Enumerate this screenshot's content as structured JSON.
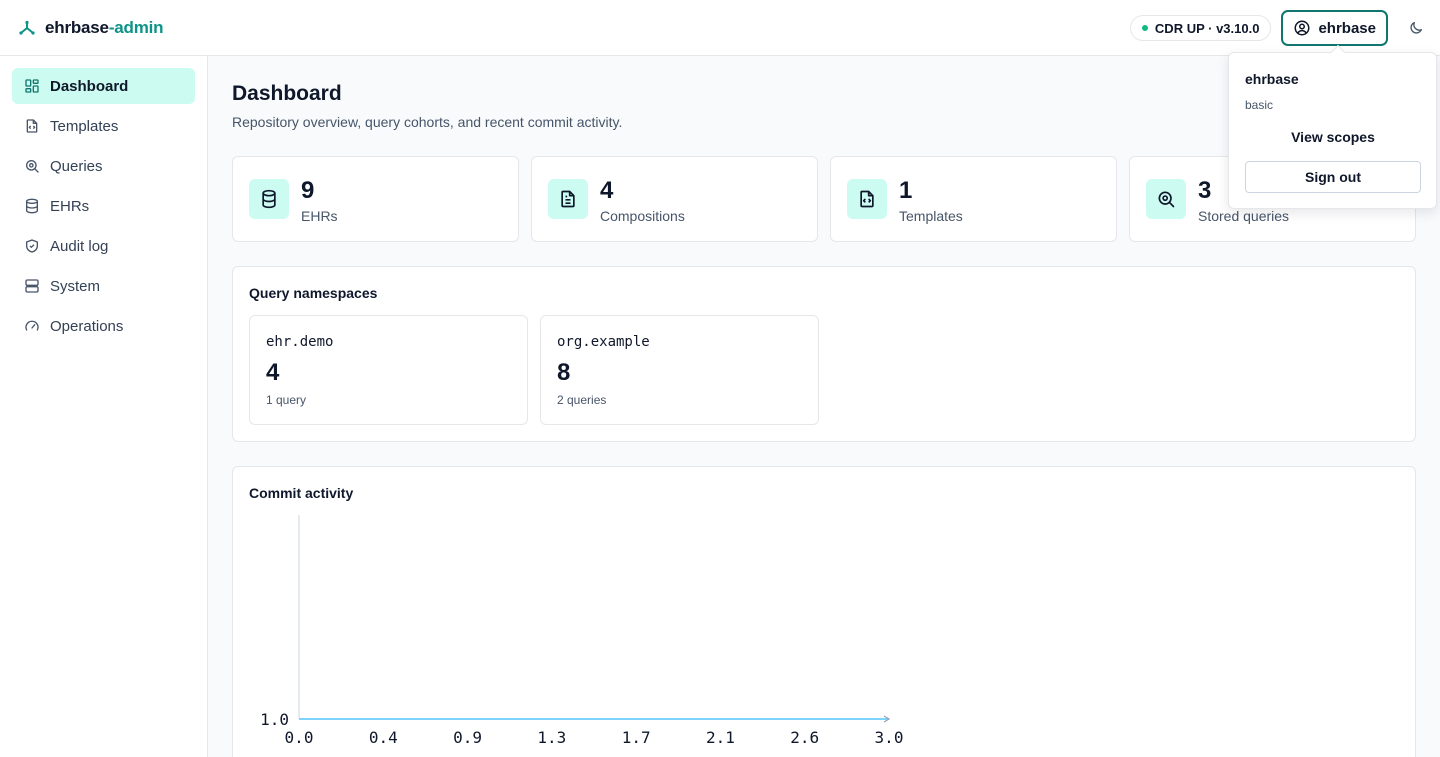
{
  "brand": {
    "name_main": "ehrbase",
    "name_accent": "-admin"
  },
  "header": {
    "status": "CDR UP · v3.10.0",
    "user": "ehrbase",
    "status_color": "#10b981",
    "accent_color": "#0d9488"
  },
  "sidebar": {
    "items": [
      {
        "label": "Dashboard",
        "icon": "dashboard-icon",
        "active": true
      },
      {
        "label": "Templates",
        "icon": "file-code-icon"
      },
      {
        "label": "Queries",
        "icon": "search-icon"
      },
      {
        "label": "EHRs",
        "icon": "database-icon"
      },
      {
        "label": "Audit log",
        "icon": "shield-check-icon"
      },
      {
        "label": "System",
        "icon": "server-icon"
      },
      {
        "label": "Operations",
        "icon": "gauge-icon"
      }
    ]
  },
  "page": {
    "title": "Dashboard",
    "subtitle": "Repository overview, query cohorts, and recent commit activity."
  },
  "stats": [
    {
      "value": "9",
      "label": "EHRs",
      "icon": "database-icon"
    },
    {
      "value": "4",
      "label": "Compositions",
      "icon": "file-text-icon"
    },
    {
      "value": "1",
      "label": "Templates",
      "icon": "file-code-icon"
    },
    {
      "value": "3",
      "label": "Stored queries",
      "icon": "search-icon"
    }
  ],
  "namespaces": {
    "title": "Query namespaces",
    "items": [
      {
        "name": "ehr.demo",
        "count": "4",
        "sub": "1 query"
      },
      {
        "name": "org.example",
        "count": "8",
        "sub": "2 queries"
      }
    ]
  },
  "commit_activity": {
    "title": "Commit activity"
  },
  "chart_data": {
    "type": "line",
    "title": "Commit activity",
    "x_ticks": [
      "0.0",
      "0.4",
      "0.9",
      "1.3",
      "1.7",
      "2.1",
      "2.6",
      "3.0"
    ],
    "y_ticks": [
      "1.0"
    ],
    "xlim": [
      0,
      3
    ],
    "ylim": [
      1,
      1
    ],
    "series": [
      {
        "x": [
          0,
          3
        ],
        "y": [
          1,
          1
        ],
        "color": "#7dd3fc"
      }
    ]
  },
  "user_menu": {
    "name": "ehrbase",
    "role": "basic",
    "view_scopes": "View scopes",
    "sign_out": "Sign out"
  }
}
